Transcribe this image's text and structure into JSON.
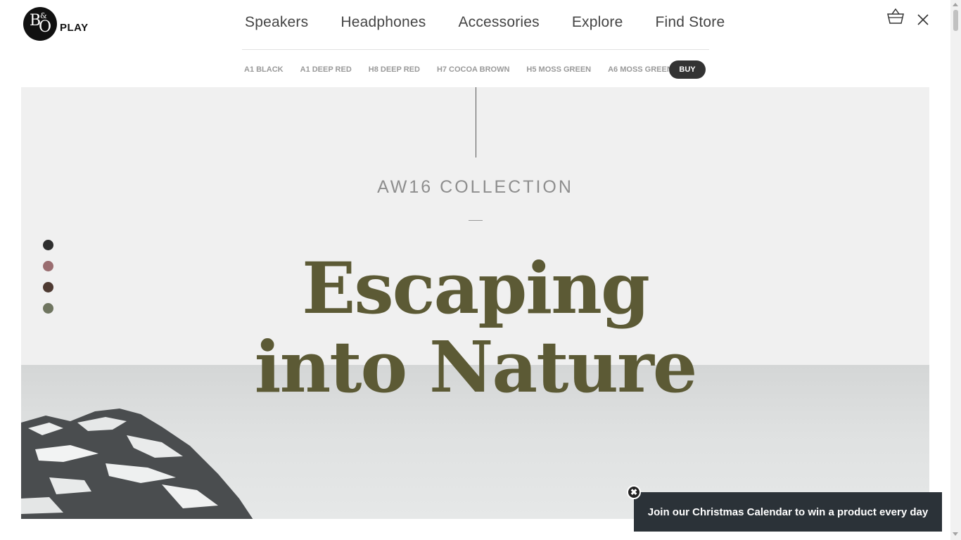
{
  "logo": {
    "brand_mark": "B&O",
    "play_label": "PLAY"
  },
  "main_nav": [
    "Speakers",
    "Headphones",
    "Accessories",
    "Explore",
    "Find Store"
  ],
  "header_icons": {
    "basket": "basket-icon",
    "close": "close-icon"
  },
  "sub_nav": [
    "A1 BLACK",
    "A1 DEEP RED",
    "H8 DEEP RED",
    "H7 COCOA BROWN",
    "H5 MOSS GREEN",
    "A6 MOSS GREEN"
  ],
  "buy_label": "BUY",
  "hero": {
    "eyebrow": "AW16 COLLECTION",
    "headline_line1": "Escaping",
    "headline_line2": "into Nature",
    "headline_color": "#5c5a35"
  },
  "color_dots": [
    {
      "name": "black",
      "color": "#2e2e2e"
    },
    {
      "name": "deep-red",
      "color": "#9a6d70"
    },
    {
      "name": "cocoa-brown",
      "color": "#4e3a32"
    },
    {
      "name": "moss-green",
      "color": "#6f7560"
    }
  ],
  "promo": {
    "text": "Join our Christmas Calendar to win a product every day"
  }
}
